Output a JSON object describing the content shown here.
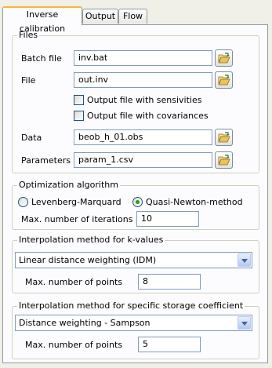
{
  "tabs": [
    "Inverse calibration",
    "Output",
    "Flow"
  ],
  "files": {
    "title": "Files",
    "batch_label": "Batch file",
    "batch_value": "inv.bat",
    "file_label": "File",
    "file_value": "out.inv",
    "sens_label": "Output file with sensivities",
    "cov_label": "Output file with covariances",
    "data_label": "Data",
    "data_value": "beob_h_01.obs",
    "params_label": "Parameters",
    "params_value": "param_1.csv"
  },
  "optimization": {
    "title": "Optimization algorithm",
    "option_lm": "Levenberg-Marquard",
    "option_qn": "Quasi-Newton-method",
    "selected": "Quasi-Newton-method",
    "max_iter_label": "Max. number of iterations",
    "max_iter_value": "10"
  },
  "kvalues": {
    "title": "Interpolation method for k-values",
    "method": "Linear distance weighting (IDM)",
    "max_points_label": "Max. number of points",
    "max_points_value": "8"
  },
  "storage": {
    "title": "Interpolation method for specific storage coefficient",
    "method": "Distance weighting - Sampson",
    "max_points_label": "Max. number of points",
    "max_points_value": "5"
  }
}
